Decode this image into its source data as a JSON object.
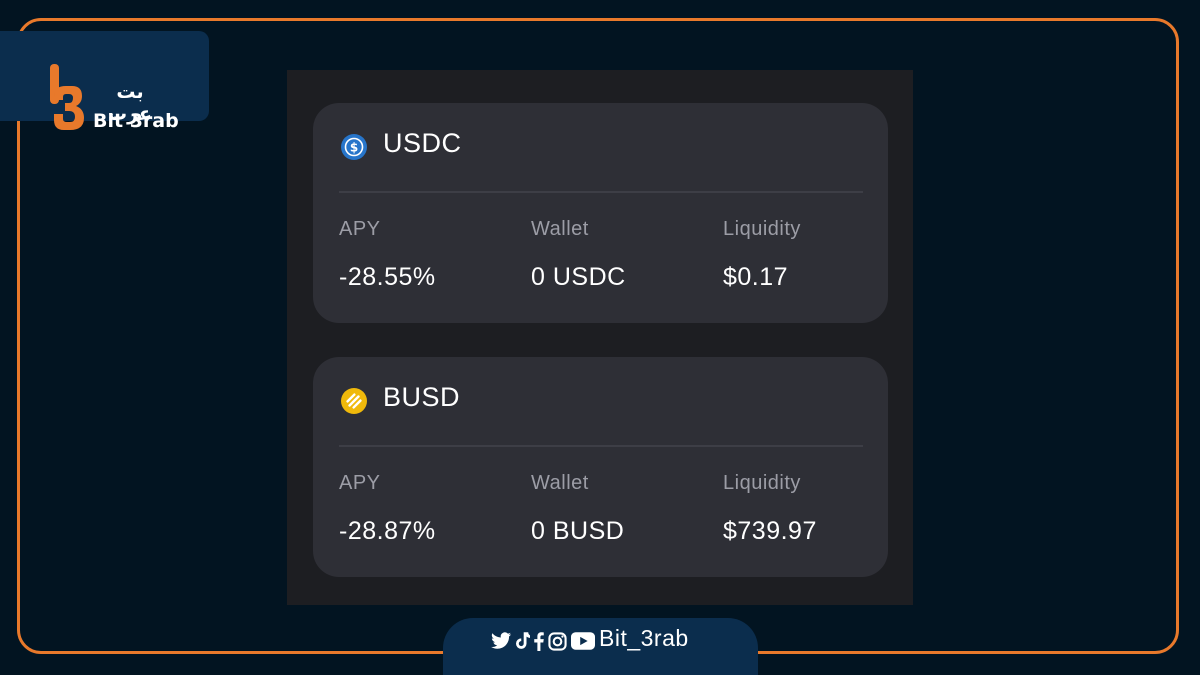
{
  "brand": {
    "name_ar": "بت عرب",
    "name_en": "Bit 3rab"
  },
  "markets": [
    {
      "token": "USDC",
      "icon": "usdc-icon",
      "apy_label": "APY",
      "apy_value": "-28.55%",
      "wallet_label": "Wallet",
      "wallet_value": "0 USDC",
      "liquidity_label": "Liquidity",
      "liquidity_value": "$0.17"
    },
    {
      "token": "BUSD",
      "icon": "busd-icon",
      "apy_label": "APY",
      "apy_value": "-28.87%",
      "wallet_label": "Wallet",
      "wallet_value": "0 BUSD",
      "liquidity_label": "Liquidity",
      "liquidity_value": "$739.97"
    }
  ],
  "footer": {
    "icons": [
      "twitter-icon",
      "tiktok-icon",
      "facebook-icon",
      "instagram-icon",
      "youtube-icon"
    ],
    "handle": "Bit_3rab"
  },
  "colors": {
    "background": "#021421",
    "frame": "#e8792b",
    "card": "#2e2f36",
    "panel": "#1d1e22",
    "usdc": "#2775ca",
    "busd": "#f0b90b"
  }
}
